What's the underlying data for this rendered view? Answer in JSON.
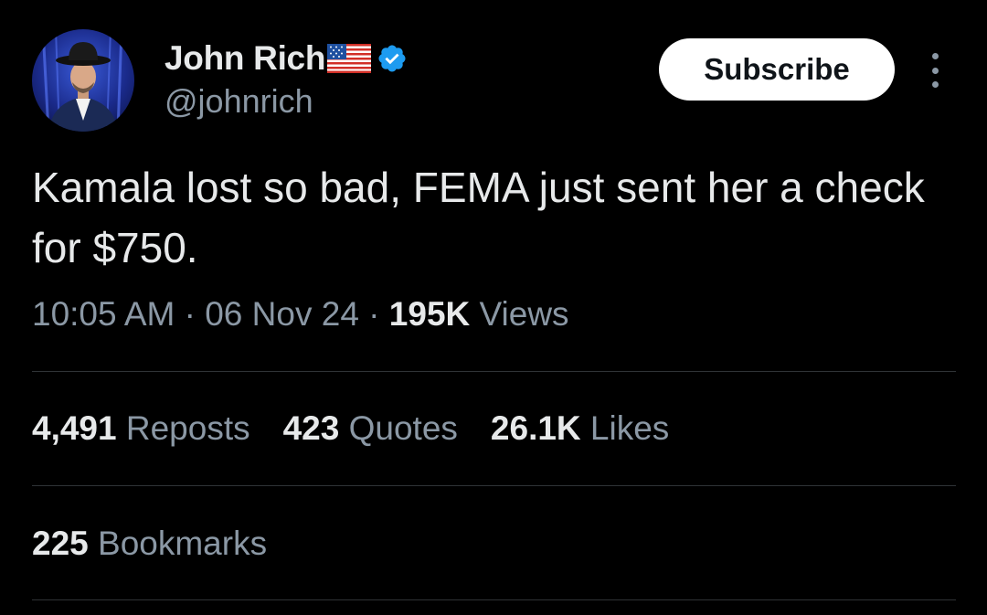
{
  "author": {
    "name": "John Rich",
    "handle": "@johnrich",
    "flag_icon": "us-flag-emoji",
    "verified_icon": "verified-badge-icon",
    "verified_color": "#1d9bf0"
  },
  "actions": {
    "subscribe_label": "Subscribe",
    "more_icon": "more-options-icon"
  },
  "tweet": {
    "text": "Kamala lost so bad, FEMA just sent her a check for $750."
  },
  "meta": {
    "time": "10:05 AM",
    "sep1": " · ",
    "date": "06 Nov 24",
    "sep2": " · ",
    "views_count": "195K",
    "views_label": " Views"
  },
  "stats": {
    "reposts_count": "4,491",
    "reposts_label": " Reposts",
    "quotes_count": "423",
    "quotes_label": " Quotes",
    "likes_count": "26.1K",
    "likes_label": " Likes",
    "bookmarks_count": "225",
    "bookmarks_label": " Bookmarks"
  },
  "colors": {
    "background": "#000000",
    "text_primary": "#e7e9ea",
    "text_secondary": "#8b98a5",
    "divider": "#2f3336"
  }
}
